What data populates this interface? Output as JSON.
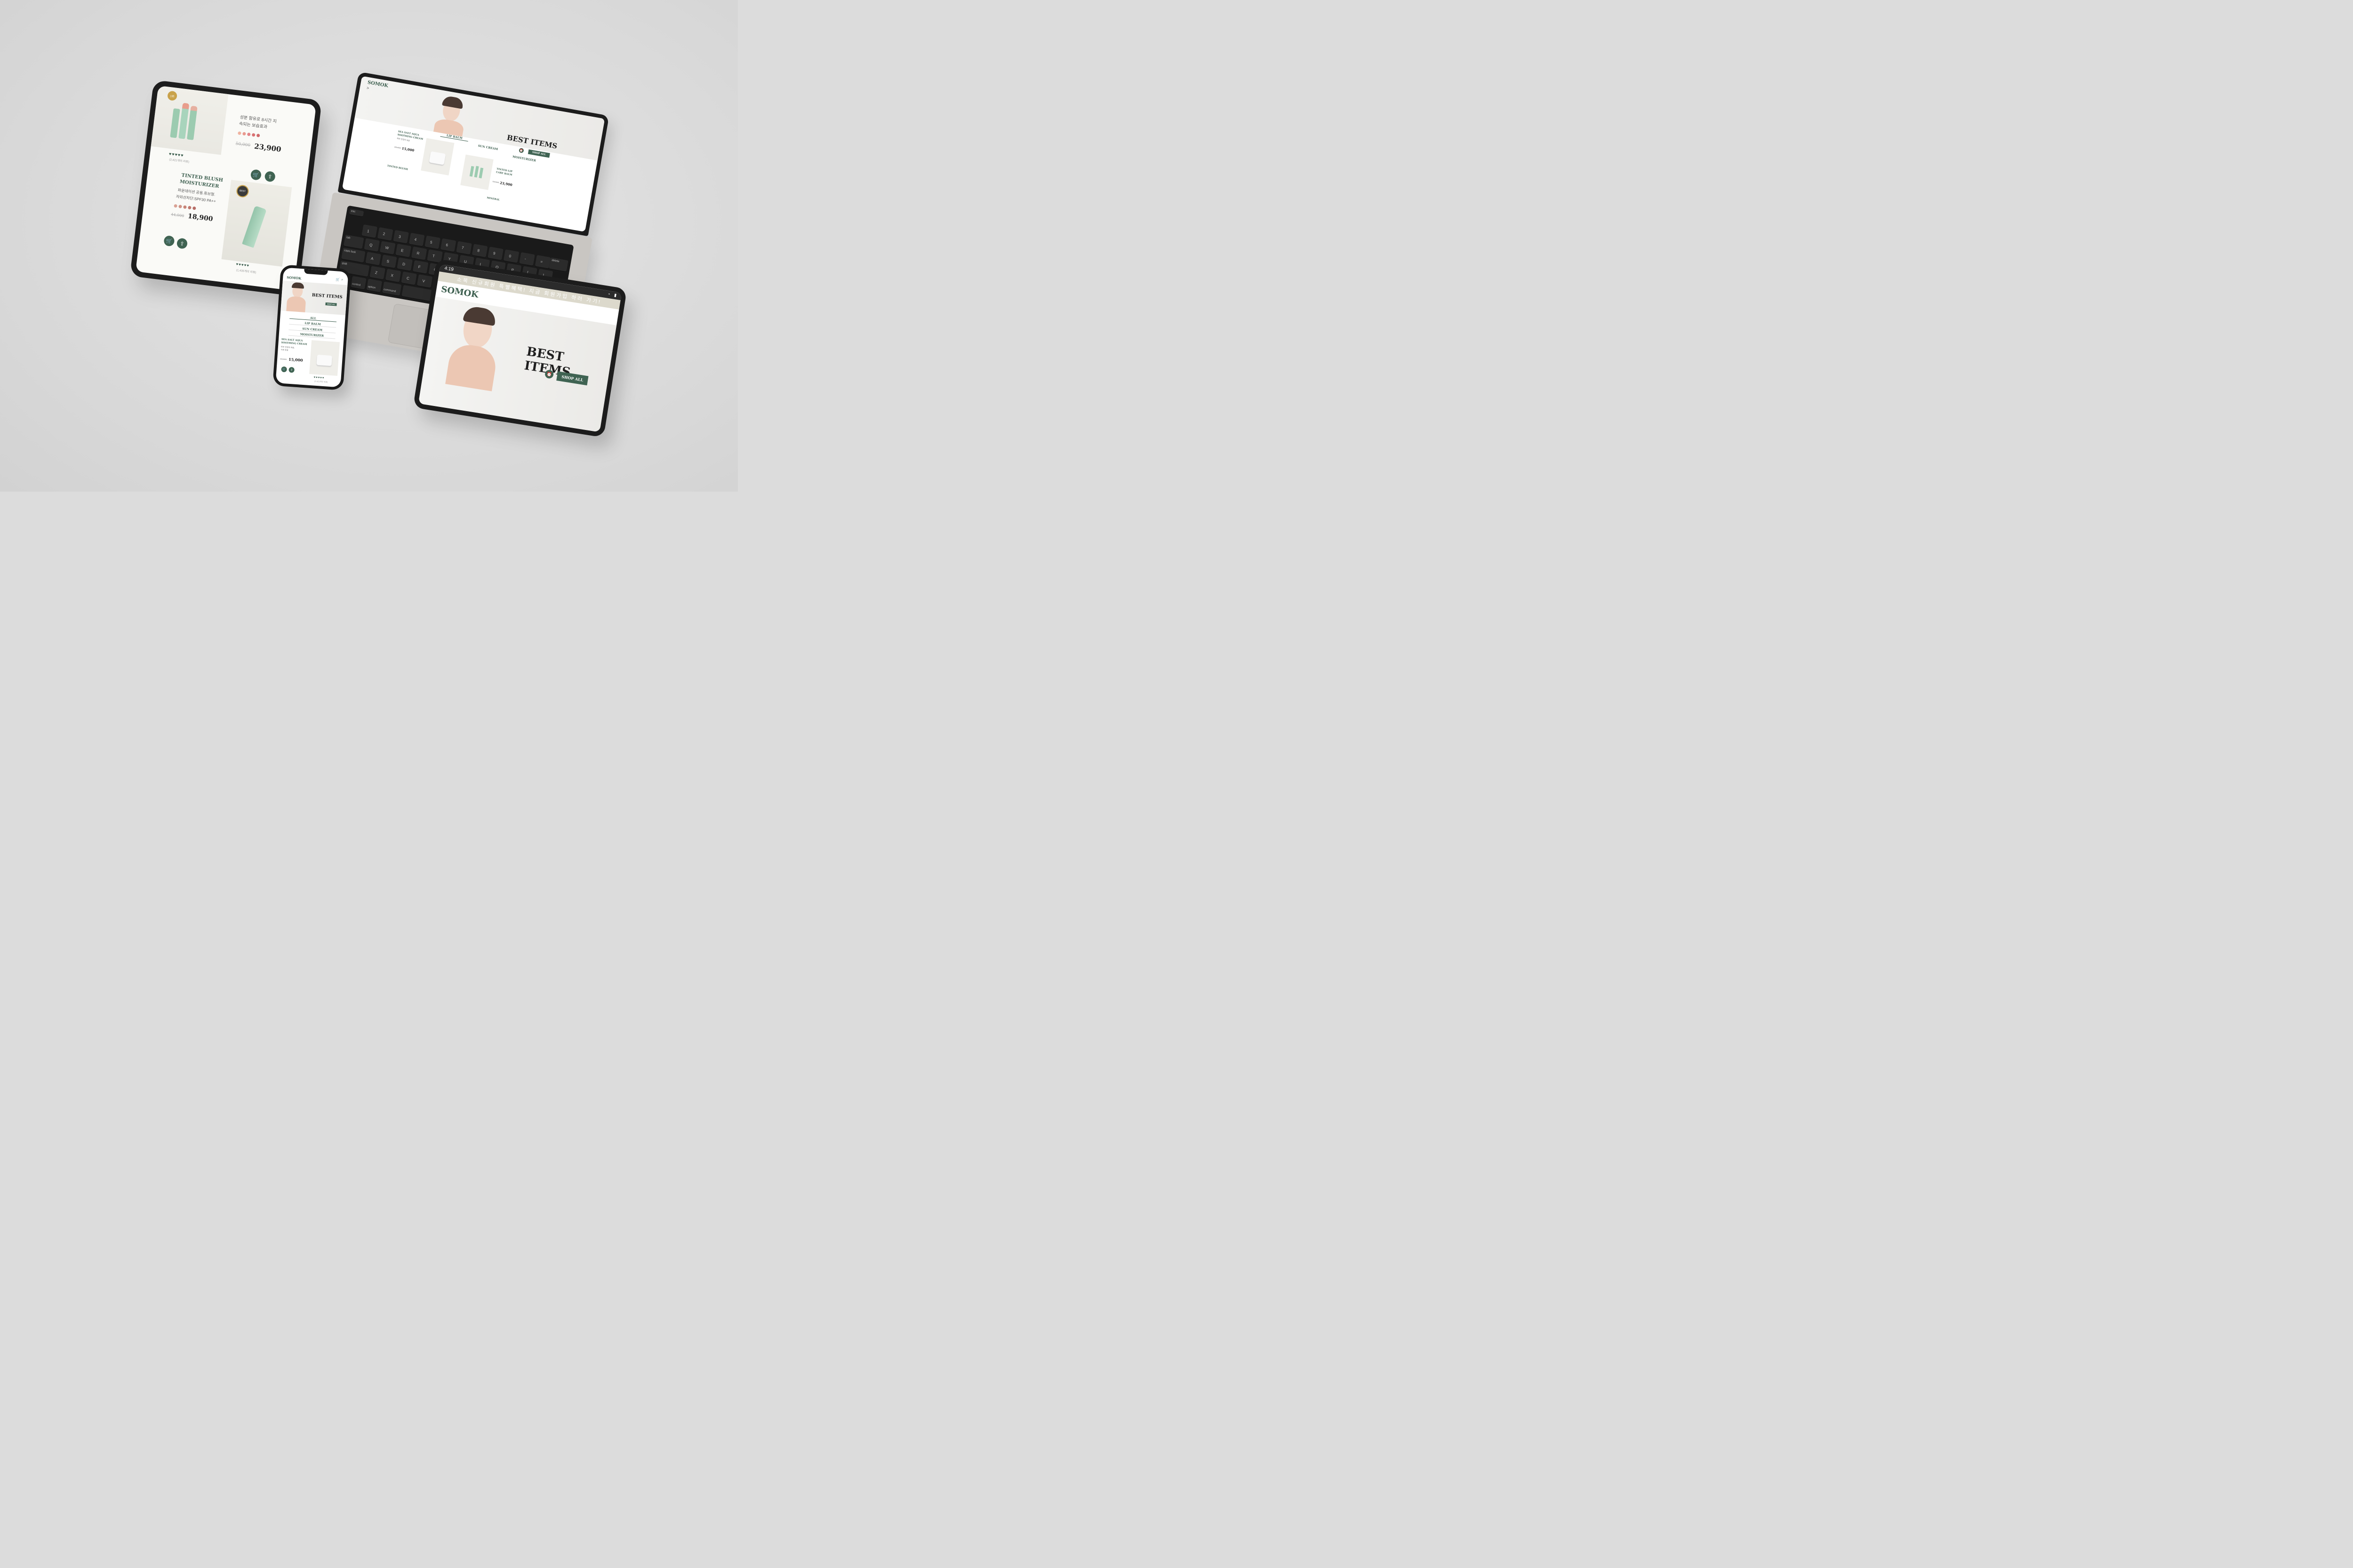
{
  "brand": {
    "name": "SOMOK",
    "accent": "#3f6352",
    "bg": "#dcdcdc"
  },
  "hero": {
    "title": "BEST ITEMS",
    "shop_all": "SHOP ALL"
  },
  "tabs": [
    "ALL",
    "LIP BALM",
    "SUN CREAM",
    "MOISTURIZER"
  ],
  "tablet_left": {
    "product1": {
      "desc_line1": "성분 함유로 8시간 지",
      "desc_line2": "속되는 보습효과",
      "old_price": "50,000",
      "price": "23,900",
      "reviews": "(2,421개의 리뷰)",
      "badge": "1위"
    },
    "product2": {
      "name_line1": "TINTED BLUSH",
      "name_line2": "MOISTURIZER",
      "desc_line1": "파운데이션 공용.튜브형.",
      "desc_line2": "자외선차단:SPF30 PA++",
      "old_price": "44,000",
      "price": "18,900",
      "reviews": "(1,435개의 리뷰)",
      "badge": "BEST"
    },
    "hearts": "♥♥♥♥♥"
  },
  "laptop": {
    "nav_arrow": ">",
    "product_left": {
      "name_line1": "SEA SALT AQUA",
      "name_line2": "SOOTHING CREAM",
      "desc": "피부 진정과 보습",
      "price": "15,000",
      "old_price": "29,000"
    },
    "product_right": {
      "name_line1": "TINTED LIP",
      "name_line2": "CARE BALM",
      "price": "23,900",
      "old_price": "50,000"
    },
    "bottom_left": "TINTED BLUSH",
    "bottom_right": "MINERAL",
    "keys": {
      "esc": "esc",
      "tab": "tab",
      "caps": "caps lock",
      "shift": "shift",
      "fn": "fn",
      "control": "control",
      "option": "option",
      "command": "command",
      "delete": "delete",
      "row1": [
        "1",
        "2",
        "3",
        "4",
        "5",
        "6",
        "7",
        "8",
        "9",
        "0",
        "-",
        "="
      ],
      "row2": [
        "Q",
        "W",
        "E",
        "R",
        "T",
        "Y",
        "U",
        "I",
        "O",
        "P",
        "[",
        "]"
      ],
      "row3": [
        "A",
        "S",
        "D",
        "F",
        "G",
        "H",
        "J",
        "K",
        "L",
        ";",
        "'"
      ],
      "row4": [
        "Z",
        "X",
        "C",
        "V",
        "B",
        "N",
        "M",
        ",",
        ".",
        "/"
      ]
    }
  },
  "phone": {
    "product": {
      "name_line1": "SEA SALT AQUA",
      "name_line2": "SOOTHING CREAM",
      "desc_line1": "피부 진정과 보습,",
      "desc_line2": "수분 공급",
      "price": "15,000",
      "old_price": "29,000",
      "reviews": "(2,421개의 리뷰)"
    },
    "hearts": "♥♥♥♥♥"
  },
  "tablet_right": {
    "time": "4:19",
    "banner": "소목 신규회원 특별혜택! 지금 회원가입 하러 가기!"
  },
  "icons": {
    "cart": "cart-icon",
    "search": "search-icon",
    "share": "share-icon",
    "heart": "heart-icon"
  }
}
